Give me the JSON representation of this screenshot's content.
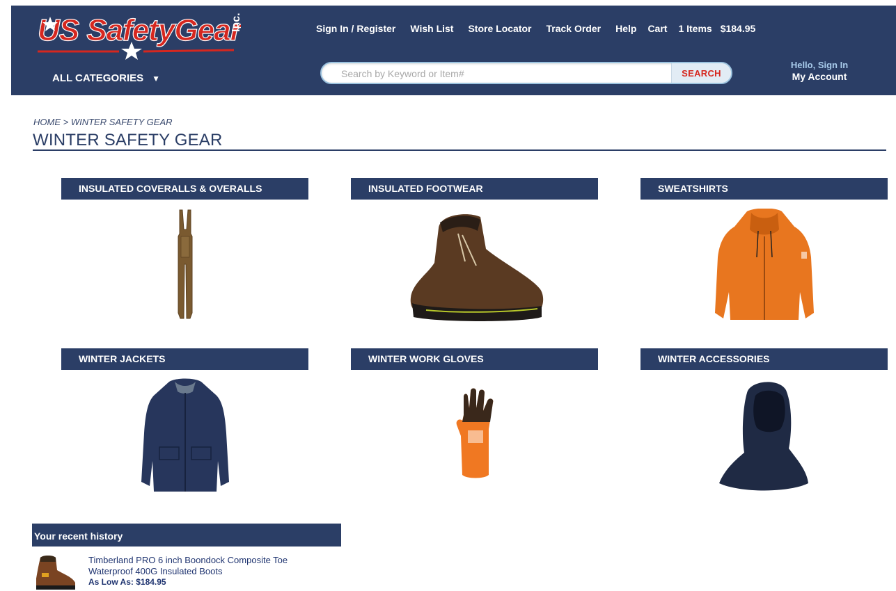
{
  "brand": {
    "logo_text": "US SafetyGear",
    "logo_suffix": "Inc."
  },
  "topnav": {
    "signin": "Sign In / Register",
    "wishlist": "Wish List",
    "store_locator": "Store Locator",
    "track_order": "Track Order",
    "help": "Help",
    "cart": "Cart",
    "cart_count": "1 Items",
    "cart_total": "$184.95"
  },
  "all_categories": "ALL CATEGORIES",
  "search": {
    "placeholder": "Search by Keyword or Item#",
    "button": "SEARCH"
  },
  "account": {
    "hello": "Hello, Sign In",
    "my_account": "My Account"
  },
  "breadcrumb": {
    "home": "HOME",
    "separator": ">",
    "current": "WINTER SAFETY GEAR"
  },
  "page_title": "WINTER SAFETY GEAR",
  "categories": [
    {
      "label": "INSULATED COVERALLS & OVERALLS",
      "icon": "bib-overalls-icon"
    },
    {
      "label": "INSULATED FOOTWEAR",
      "icon": "work-boot-icon"
    },
    {
      "label": "SWEATSHIRTS",
      "icon": "hooded-sweatshirt-icon"
    },
    {
      "label": "WINTER JACKETS",
      "icon": "winter-jacket-icon"
    },
    {
      "label": "WINTER WORK GLOVES",
      "icon": "work-glove-icon"
    },
    {
      "label": "WINTER ACCESSORIES",
      "icon": "balaclava-hood-icon"
    }
  ],
  "recent_history": {
    "title": "Your recent history",
    "items": [
      {
        "name": "Timberland PRO 6 inch Boondock Composite Toe Waterproof 400G Insulated Boots",
        "price": "As Low As: $184.95",
        "icon": "boot-thumbnail-icon"
      }
    ]
  },
  "colors": {
    "navy": "#2b3e66",
    "accent_red": "#d6271f",
    "link_blue": "#a9ccec"
  }
}
